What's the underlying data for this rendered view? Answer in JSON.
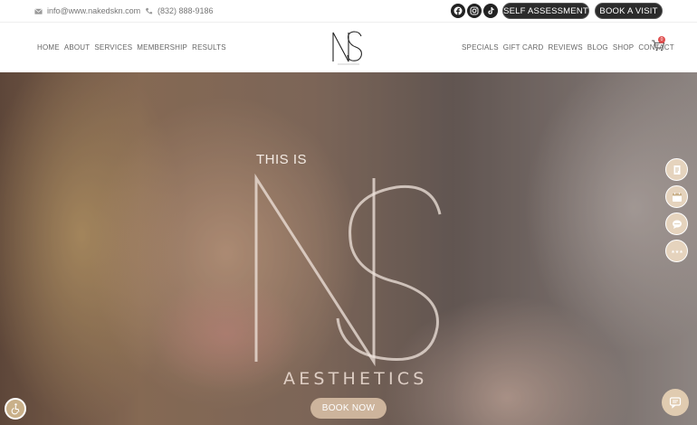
{
  "topbar": {
    "email": "info@www.nakedskn.com",
    "phone": "(832) 888-9186",
    "socials": [
      "facebook-icon",
      "instagram-icon",
      "tiktok-icon"
    ],
    "self_assessment": "SELF ASSESSMENT",
    "book_visit": "BOOK A VISIT"
  },
  "nav": {
    "left": [
      "HOME",
      "ABOUT",
      "SERVICES",
      "MEMBERSHIP",
      "RESULTS"
    ],
    "right": [
      "SPECIALS",
      "GIFT CARD",
      "REVIEWS",
      "BLOG",
      "SHOP",
      "CONTACT"
    ],
    "cart_count": "0"
  },
  "hero": {
    "prefix": "THIS IS",
    "wordmark": "AESTHETICS",
    "cta": "BOOK NOW"
  },
  "side_buttons": [
    "document-icon",
    "calendar-icon",
    "chat-bubble-icon",
    "star-rating-icon"
  ],
  "colors": {
    "accent": "#cdb49c",
    "dark_button": "#2b2b2b",
    "side_button": "#e5d3bd"
  }
}
